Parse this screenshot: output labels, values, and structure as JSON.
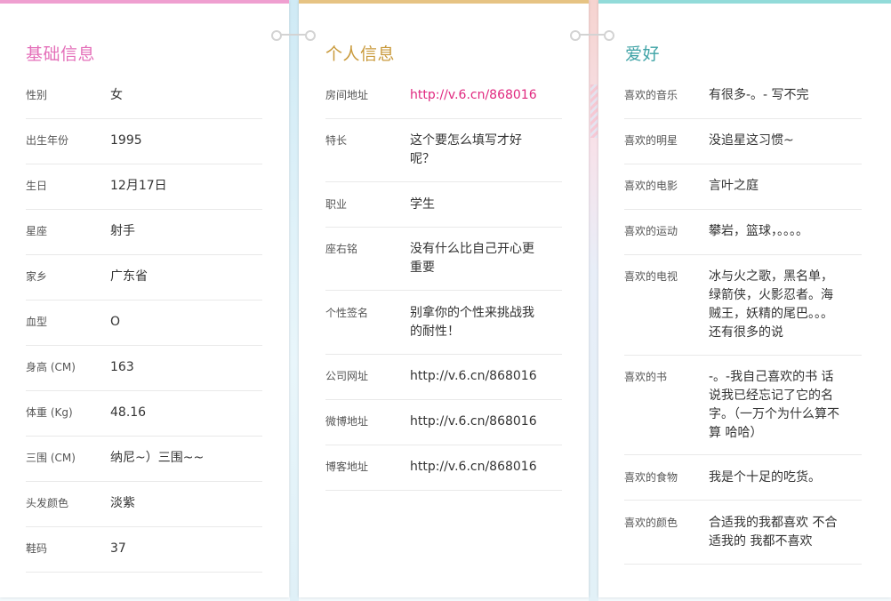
{
  "basic": {
    "title": "基础信息",
    "rows": [
      {
        "label": "性别",
        "value": "女"
      },
      {
        "label": "出生年份",
        "value": "1995"
      },
      {
        "label": "生日",
        "value": "12月17日"
      },
      {
        "label": "星座",
        "value": "射手"
      },
      {
        "label": "家乡",
        "value": "广东省"
      },
      {
        "label": "血型",
        "value": "O"
      },
      {
        "label": "身高 (CM)",
        "value": "163"
      },
      {
        "label": "体重 (Kg)",
        "value": "48.16"
      },
      {
        "label": "三围 (CM)",
        "value": "纳尼~）三围~~"
      },
      {
        "label": "头发颜色",
        "value": "淡紫"
      },
      {
        "label": "鞋码",
        "value": "37"
      }
    ]
  },
  "personal": {
    "title": "个人信息",
    "rows": [
      {
        "label": "房间地址",
        "value": "http://v.6.cn/868016"
      },
      {
        "label": "特长",
        "value": "这个要怎么填写才好呢？"
      },
      {
        "label": "职业",
        "value": "学生"
      },
      {
        "label": "座右铭",
        "value": "没有什么比自己开心更重要"
      },
      {
        "label": "个性签名",
        "value": "别拿你的个性来挑战我的耐性！"
      },
      {
        "label": "公司网址",
        "value": "http://v.6.cn/868016"
      },
      {
        "label": "微博地址",
        "value": "http://v.6.cn/868016"
      },
      {
        "label": "博客地址",
        "value": "http://v.6.cn/868016"
      }
    ]
  },
  "hobby": {
    "title": "爱好",
    "rows": [
      {
        "label": "喜欢的音乐",
        "value": "有很多-。- 写不完"
      },
      {
        "label": "喜欢的明星",
        "value": "没追星这习惯~"
      },
      {
        "label": "喜欢的电影",
        "value": "言叶之庭"
      },
      {
        "label": "喜欢的运动",
        "value": "攀岩，篮球，。。。。"
      },
      {
        "label": "喜欢的电视",
        "value": "冰与火之歌，黑名单，绿箭侠，火影忍者。海贼王，妖精的尾巴。。。还有很多的说"
      },
      {
        "label": "喜欢的书",
        "value": "-。-我自己喜欢的书 话说我已经忘记了它的名字。（一万个为什么算不算 哈哈）"
      },
      {
        "label": "喜欢的食物",
        "value": "我是个十足的吃货。"
      },
      {
        "label": "喜欢的颜色",
        "value": "合适我的我都喜欢 不合适我的 我都不喜欢"
      }
    ]
  },
  "colors": {
    "basic_accent": "#e46fb9",
    "personal_accent": "#c99a3c",
    "hobby_accent": "#3fa3a6",
    "link": "#e0287f"
  }
}
